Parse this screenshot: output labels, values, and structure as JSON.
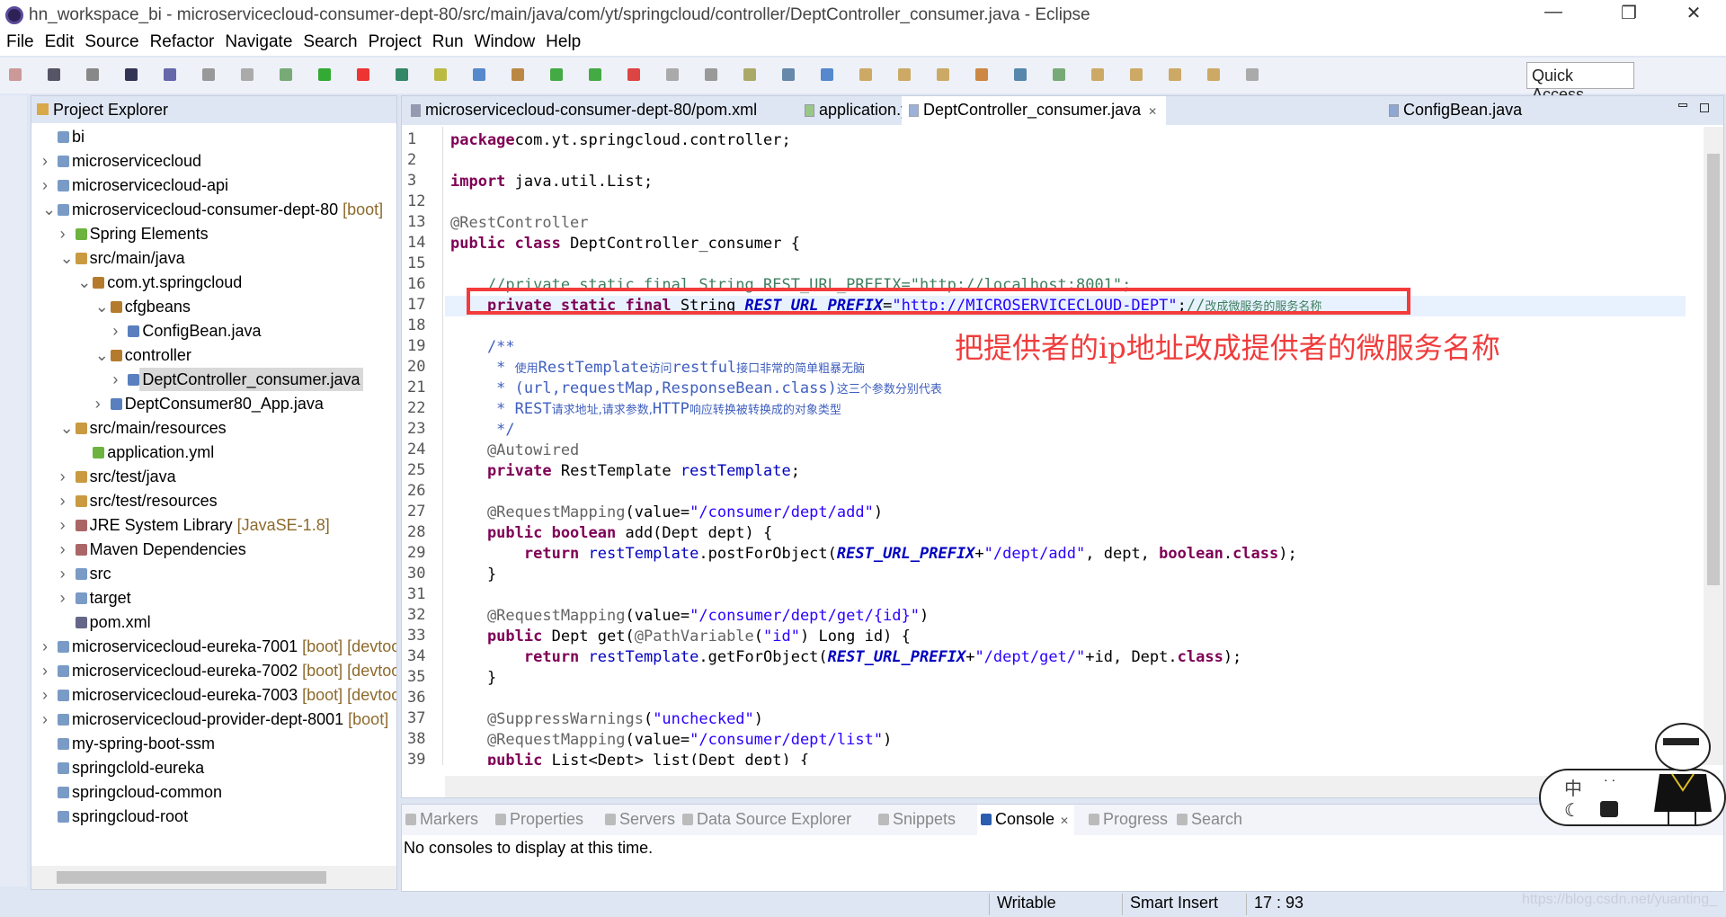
{
  "window": {
    "title": "hn_workspace_bi - microservicecloud-consumer-dept-80/src/main/java/com/yt/springcloud/controller/DeptController_consumer.java - Eclipse",
    "minimize": "—",
    "restore": "❐",
    "close": "✕"
  },
  "menu": [
    "File",
    "Edit",
    "Source",
    "Refactor",
    "Navigate",
    "Search",
    "Project",
    "Run",
    "Window",
    "Help"
  ],
  "toolbar": {
    "quick_access": "Quick Access"
  },
  "explorer": {
    "title": "Project Explorer",
    "items": [
      {
        "label": "bi",
        "level": 0,
        "arrow": "",
        "icon": "folder"
      },
      {
        "label": "microservicecloud",
        "level": 0,
        "arrow": ">",
        "icon": "project"
      },
      {
        "label": "microservicecloud-api",
        "level": 0,
        "arrow": ">",
        "icon": "project"
      },
      {
        "label": "microservicecloud-consumer-dept-80",
        "dec": "[boot]",
        "level": 0,
        "arrow": "v",
        "icon": "project"
      },
      {
        "label": "Spring Elements",
        "level": 1,
        "arrow": ">",
        "icon": "spring"
      },
      {
        "label": "src/main/java",
        "level": 1,
        "arrow": "v",
        "icon": "srcfolder"
      },
      {
        "label": "com.yt.springcloud",
        "level": 2,
        "arrow": "v",
        "icon": "package"
      },
      {
        "label": "cfgbeans",
        "level": 3,
        "arrow": "v",
        "icon": "package"
      },
      {
        "label": "ConfigBean.java",
        "level": 4,
        "arrow": ">",
        "icon": "java"
      },
      {
        "label": "controller",
        "level": 3,
        "arrow": "v",
        "icon": "package"
      },
      {
        "label": "DeptController_consumer.java",
        "level": 4,
        "arrow": ">",
        "icon": "java",
        "selected": true
      },
      {
        "label": "DeptConsumer80_App.java",
        "level": 3,
        "arrow": ">",
        "icon": "java"
      },
      {
        "label": "src/main/resources",
        "level": 1,
        "arrow": "v",
        "icon": "srcfolder"
      },
      {
        "label": "application.yml",
        "level": 2,
        "arrow": "",
        "icon": "yml"
      },
      {
        "label": "src/test/java",
        "level": 1,
        "arrow": ">",
        "icon": "srcfolder"
      },
      {
        "label": "src/test/resources",
        "level": 1,
        "arrow": ">",
        "icon": "srcfolder"
      },
      {
        "label": "JRE System Library",
        "dec": "[JavaSE-1.8]",
        "level": 1,
        "arrow": ">",
        "icon": "library"
      },
      {
        "label": "Maven Dependencies",
        "level": 1,
        "arrow": ">",
        "icon": "library"
      },
      {
        "label": "src",
        "level": 1,
        "arrow": ">",
        "icon": "folder"
      },
      {
        "label": "target",
        "level": 1,
        "arrow": ">",
        "icon": "folder"
      },
      {
        "label": "pom.xml",
        "level": 1,
        "arrow": "",
        "icon": "xml"
      },
      {
        "label": "microservicecloud-eureka-7001",
        "dec": "[boot] [devtools]",
        "level": 0,
        "arrow": ">",
        "icon": "project"
      },
      {
        "label": "microservicecloud-eureka-7002",
        "dec": "[boot] [devtools]",
        "level": 0,
        "arrow": ">",
        "icon": "project"
      },
      {
        "label": "microservicecloud-eureka-7003",
        "dec": "[boot] [devtools]",
        "level": 0,
        "arrow": ">",
        "icon": "project"
      },
      {
        "label": "microservicecloud-provider-dept-8001",
        "dec": "[boot]",
        "level": 0,
        "arrow": ">",
        "icon": "project"
      },
      {
        "label": "my-spring-boot-ssm",
        "level": 0,
        "arrow": "",
        "icon": "folder"
      },
      {
        "label": "springclold-eureka",
        "level": 0,
        "arrow": "",
        "icon": "folder"
      },
      {
        "label": "springcloud-common",
        "level": 0,
        "arrow": "",
        "icon": "folder"
      },
      {
        "label": "springcloud-root",
        "level": 0,
        "arrow": "",
        "icon": "folder"
      }
    ]
  },
  "editor": {
    "tabs": [
      {
        "label": "microservicecloud-consumer-dept-80/pom.xml",
        "icon": "xml"
      },
      {
        "label": "application.yml",
        "icon": "yml"
      },
      {
        "label": "DeptController_consumer.java",
        "icon": "java",
        "active": true,
        "close": "✕"
      },
      {
        "label": "ConfigBean.java",
        "icon": "java"
      }
    ],
    "current_line": "17",
    "lines": [
      {
        "n": "1",
        "t": [
          [
            "kw",
            "package"
          ],
          [
            "",
            "com.yt.springcloud.controller;"
          ]
        ]
      },
      {
        "n": "2",
        "t": []
      },
      {
        "n": "3",
        "t": [
          [
            "kw",
            "import"
          ],
          [
            "",
            " java.util.List;"
          ]
        ]
      },
      {
        "n": "12",
        "t": []
      },
      {
        "n": "13",
        "t": [
          [
            "an",
            "@RestController"
          ]
        ]
      },
      {
        "n": "14",
        "t": [
          [
            "kw",
            "public class"
          ],
          [
            "",
            " DeptController_consumer {"
          ]
        ]
      },
      {
        "n": "15",
        "t": []
      },
      {
        "n": "16",
        "t": [
          [
            "cm",
            "    //private static final String REST_URL_PREFIX=\"http://localhost:8001\";"
          ]
        ]
      },
      {
        "n": "17",
        "t": [
          [
            "",
            "    "
          ],
          [
            "kw",
            "private static final"
          ],
          [
            "",
            " String "
          ],
          [
            "fi",
            "REST_URL_PREFIX"
          ],
          [
            "",
            "="
          ],
          [
            "st",
            "\"http://MICROSERVICECLOUD-DEPT\""
          ],
          [
            "",
            ";"
          ],
          [
            "cm",
            "//"
          ],
          [
            "cm cn",
            "改成微服务的服务名称"
          ]
        ]
      },
      {
        "n": "18",
        "t": []
      },
      {
        "n": "19",
        "t": [
          [
            "jd",
            "    /**"
          ]
        ]
      },
      {
        "n": "20",
        "t": [
          [
            "jd",
            "     * "
          ],
          [
            "jd cn",
            "使用"
          ],
          [
            "jd",
            "RestTemplate"
          ],
          [
            "jd cn",
            "访问"
          ],
          [
            "jd",
            "restful"
          ],
          [
            "jd cn",
            "接口非常的简单粗暴无脑"
          ]
        ]
      },
      {
        "n": "21",
        "t": [
          [
            "jd",
            "     * (url,requestMap,ResponseBean.class)"
          ],
          [
            "jd cn",
            "这三个参数分别代表"
          ]
        ]
      },
      {
        "n": "22",
        "t": [
          [
            "jd",
            "     * REST"
          ],
          [
            "jd cn",
            "请求地址,请求参数,"
          ],
          [
            "jd",
            "HTTP"
          ],
          [
            "jd cn",
            "响应转换被转换成的对象类型"
          ]
        ]
      },
      {
        "n": "23",
        "t": [
          [
            "jd",
            "     */"
          ]
        ]
      },
      {
        "n": "24",
        "t": [
          [
            "an",
            "    @Autowired"
          ]
        ]
      },
      {
        "n": "25",
        "t": [
          [
            "kw",
            "    private"
          ],
          [
            "",
            " RestTemplate "
          ],
          [
            "fl",
            "restTemplate"
          ],
          [
            "",
            ";"
          ]
        ]
      },
      {
        "n": "26",
        "t": []
      },
      {
        "n": "27",
        "t": [
          [
            "an",
            "    @RequestMapping"
          ],
          [
            "",
            "(value="
          ],
          [
            "st",
            "\"/consumer/dept/add\""
          ],
          [
            "",
            ")"
          ]
        ]
      },
      {
        "n": "28",
        "t": [
          [
            "kw",
            "    public boolean"
          ],
          [
            "",
            " add(Dept dept) {"
          ]
        ]
      },
      {
        "n": "29",
        "t": [
          [
            "kw",
            "        return"
          ],
          [
            " fl",
            " restTemplate"
          ],
          [
            "",
            ".postForObject("
          ],
          [
            "fi",
            "REST_URL_PREFIX"
          ],
          [
            "",
            "+"
          ],
          [
            "st",
            "\"/dept/add\""
          ],
          [
            "",
            ", dept, "
          ],
          [
            "kw",
            "boolean"
          ],
          [
            "",
            "."
          ],
          [
            "kw",
            "class"
          ],
          [
            "",
            ");"
          ]
        ]
      },
      {
        "n": "30",
        "t": [
          [
            "",
            "    }"
          ]
        ]
      },
      {
        "n": "31",
        "t": []
      },
      {
        "n": "32",
        "t": [
          [
            "an",
            "    @RequestMapping"
          ],
          [
            "",
            "(value="
          ],
          [
            "st",
            "\"/consumer/dept/get/{id}\""
          ],
          [
            "",
            ")"
          ]
        ]
      },
      {
        "n": "33",
        "t": [
          [
            "kw",
            "    public"
          ],
          [
            "",
            " Dept get("
          ],
          [
            "an",
            "@PathVariable"
          ],
          [
            "",
            "("
          ],
          [
            "st",
            "\"id\""
          ],
          [
            "",
            ") Long id) {"
          ]
        ]
      },
      {
        "n": "34",
        "t": [
          [
            "kw",
            "        return"
          ],
          [
            "fl",
            " restTemplate"
          ],
          [
            "",
            ".getForObject("
          ],
          [
            "fi",
            "REST_URL_PREFIX"
          ],
          [
            "",
            "+"
          ],
          [
            "st",
            "\"/dept/get/\""
          ],
          [
            "",
            "+id, Dept."
          ],
          [
            "kw",
            "class"
          ],
          [
            "",
            ");"
          ]
        ]
      },
      {
        "n": "35",
        "t": [
          [
            "",
            "    }"
          ]
        ]
      },
      {
        "n": "36",
        "t": []
      },
      {
        "n": "37",
        "t": [
          [
            "an",
            "    @SuppressWarnings"
          ],
          [
            "",
            "("
          ],
          [
            "st",
            "\"unchecked\""
          ],
          [
            "",
            ")"
          ]
        ]
      },
      {
        "n": "38",
        "t": [
          [
            "an",
            "    @RequestMapping"
          ],
          [
            "",
            "(value="
          ],
          [
            "st",
            "\"/consumer/dept/list\""
          ],
          [
            "",
            ")"
          ]
        ]
      },
      {
        "n": "39",
        "t": [
          [
            "kw",
            "    public"
          ],
          [
            "",
            " List<Dept> list(Dept dept) {"
          ]
        ]
      }
    ],
    "annotation": "把提供者的ip地址改成提供者的微服务名称"
  },
  "bottom": {
    "tabs": [
      {
        "label": "Markers"
      },
      {
        "label": "Properties"
      },
      {
        "label": "Servers"
      },
      {
        "label": "Data Source Explorer"
      },
      {
        "label": "Snippets"
      },
      {
        "label": "Console",
        "active": true,
        "close": "✕"
      },
      {
        "label": "Progress"
      },
      {
        "label": "Search"
      }
    ],
    "console_message": "No consoles to display at this time."
  },
  "status": {
    "mode": "Writable",
    "insert": "Smart Insert",
    "position": "17 : 93"
  },
  "watermark": "https://blog.csdn.net/yuanting_",
  "ime": {
    "lang": "中",
    "punct": "· ·"
  },
  "colors": {
    "keyword": "#7f0055",
    "string": "#2a00ff",
    "comment": "#3f7f5f",
    "javadoc": "#3f5fbf",
    "field": "#0000c0",
    "annotation_text": "#f03c3c",
    "highlight_box": "#f43b3b"
  }
}
